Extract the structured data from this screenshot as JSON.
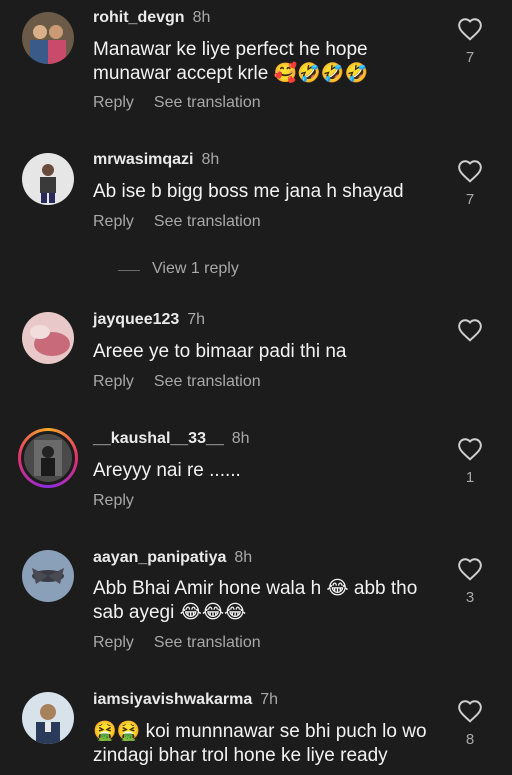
{
  "actions": {
    "reply": "Reply",
    "see_translation": "See translation",
    "view_replies": "View 1 reply"
  },
  "comments": [
    {
      "username": "rohit_devgn",
      "time": "8h",
      "text": "Manawar ke liye perfect he hope munawar accept krle 🥰🤣🤣🤣",
      "likes": "7",
      "avatar_color": "#8a6a4a"
    },
    {
      "username": "mrwasimqazi",
      "time": "8h",
      "text": "Ab ise b bigg boss me jana h shayad",
      "likes": "7",
      "avatar_color": "#cfcfcf"
    },
    {
      "username": "jayquee123",
      "time": "7h",
      "text": "Areee ye to bimaar padi thi na",
      "likes": "",
      "avatar_color": "#d9a0a0"
    },
    {
      "username": "__kaushal__33__",
      "time": "8h",
      "text": "Areyyy nai re ......",
      "likes": "1",
      "avatar_color": "#555555"
    },
    {
      "username": "aayan_panipatiya",
      "time": "8h",
      "text": "Abb Bhai Amir hone wala h 😂 abb tho sab ayegi 😂😂😂",
      "likes": "3",
      "avatar_color": "#7f93a8"
    },
    {
      "username": "iamsiyavishwakarma",
      "time": "7h",
      "text": "🤮🤮 koi munnnawar se bhi puch lo wo zindagi bhar trol hone ke liye ready",
      "likes": "8",
      "avatar_color": "#c8d4de"
    }
  ]
}
